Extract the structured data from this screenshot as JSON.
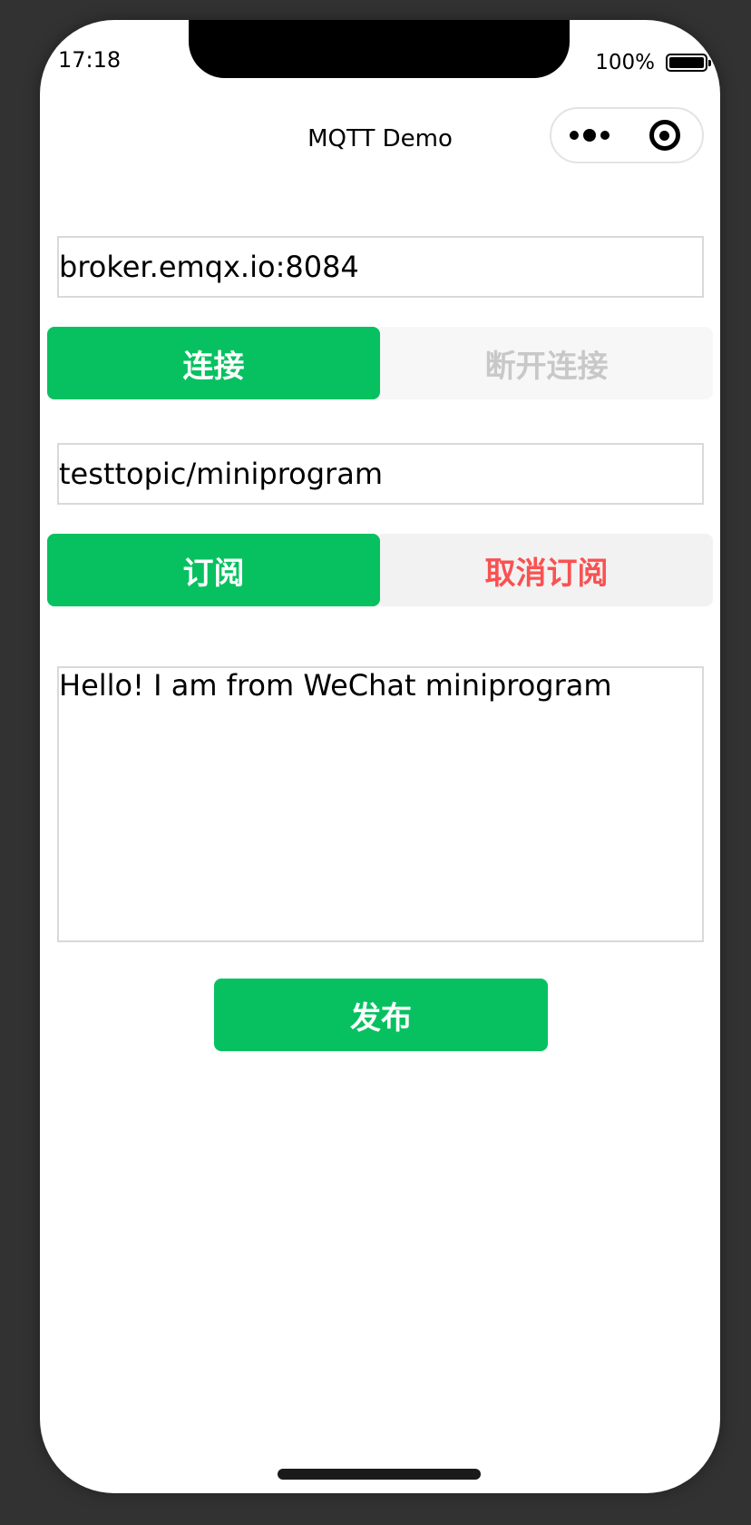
{
  "status_bar": {
    "time": "17:18",
    "battery_percent_text": "100%",
    "battery_level": 1.0
  },
  "nav": {
    "title": "MQTT Demo",
    "more_icon": "more-dots-icon",
    "close_icon": "target-circle-icon"
  },
  "form": {
    "broker_value": "broker.emqx.io:8084",
    "connect_label": "连接",
    "disconnect_label": "断开连接",
    "topic_value": "testtopic/miniprogram",
    "subscribe_label": "订阅",
    "unsubscribe_label": "取消订阅",
    "message_value": "Hello! I am from WeChat miniprogram",
    "publish_label": "发布"
  },
  "colors": {
    "primary_green": "#07c160",
    "danger_red": "#fa5151",
    "disabled_text": "#c8c8c8"
  }
}
